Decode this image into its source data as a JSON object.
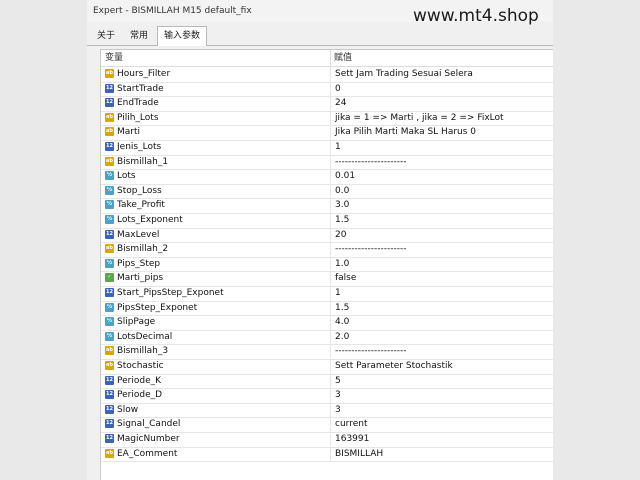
{
  "window": {
    "title": "Expert - BISMILLAH M15 default_fix"
  },
  "watermark": "www.mt4.shop",
  "tabs": [
    {
      "label": "关于"
    },
    {
      "label": "常用"
    },
    {
      "label": "输入参数"
    }
  ],
  "table": {
    "headers": {
      "variable": "变量",
      "value": "赋值"
    },
    "rows": [
      {
        "icon": "abc",
        "name": "Hours_Filter",
        "value": "Sett Jam Trading Sesuai Selera"
      },
      {
        "icon": "int",
        "name": "StartTrade",
        "value": "0"
      },
      {
        "icon": "int",
        "name": "EndTrade",
        "value": "24"
      },
      {
        "icon": "abc",
        "name": "Pilih_Lots",
        "value": "jika = 1 => Marti , jika = 2 => FixLot"
      },
      {
        "icon": "abc",
        "name": "Marti",
        "value": "Jika Pilih Marti Maka SL Harus 0"
      },
      {
        "icon": "int",
        "name": "Jenis_Lots",
        "value": "1"
      },
      {
        "icon": "abc",
        "name": "Bismillah_1",
        "value": "----------------------"
      },
      {
        "icon": "dbl",
        "name": "Lots",
        "value": "0.01"
      },
      {
        "icon": "dbl",
        "name": "Stop_Loss",
        "value": "0.0"
      },
      {
        "icon": "dbl",
        "name": "Take_Profit",
        "value": "3.0"
      },
      {
        "icon": "dbl",
        "name": "Lots_Exponent",
        "value": "1.5"
      },
      {
        "icon": "int",
        "name": "MaxLevel",
        "value": "20"
      },
      {
        "icon": "abc",
        "name": "Bismillah_2",
        "value": "----------------------"
      },
      {
        "icon": "dbl",
        "name": "Pips_Step",
        "value": "1.0"
      },
      {
        "icon": "bool",
        "name": "Marti_pips",
        "value": "false"
      },
      {
        "icon": "int",
        "name": "Start_PipsStep_Exponet",
        "value": "1"
      },
      {
        "icon": "dbl",
        "name": "PipsStep_Exponet",
        "value": "1.5"
      },
      {
        "icon": "dbl",
        "name": "SlipPage",
        "value": "4.0"
      },
      {
        "icon": "dbl",
        "name": "LotsDecimal",
        "value": "2.0"
      },
      {
        "icon": "abc",
        "name": "Bismillah_3",
        "value": "----------------------"
      },
      {
        "icon": "abc",
        "name": "Stochastic",
        "value": "Sett Parameter Stochastik"
      },
      {
        "icon": "int",
        "name": "Periode_K",
        "value": "5"
      },
      {
        "icon": "int",
        "name": "Periode_D",
        "value": "3"
      },
      {
        "icon": "int",
        "name": "Slow",
        "value": "3"
      },
      {
        "icon": "int",
        "name": "Signal_Candel",
        "value": "current"
      },
      {
        "icon": "int",
        "name": "MagicNumber",
        "value": "163991"
      },
      {
        "icon": "abc",
        "name": "EA_Comment",
        "value": "BISMILLAH"
      }
    ]
  },
  "icon_labels": {
    "abc": "ab",
    "int": "12",
    "dbl": "½",
    "bool": "✓"
  }
}
